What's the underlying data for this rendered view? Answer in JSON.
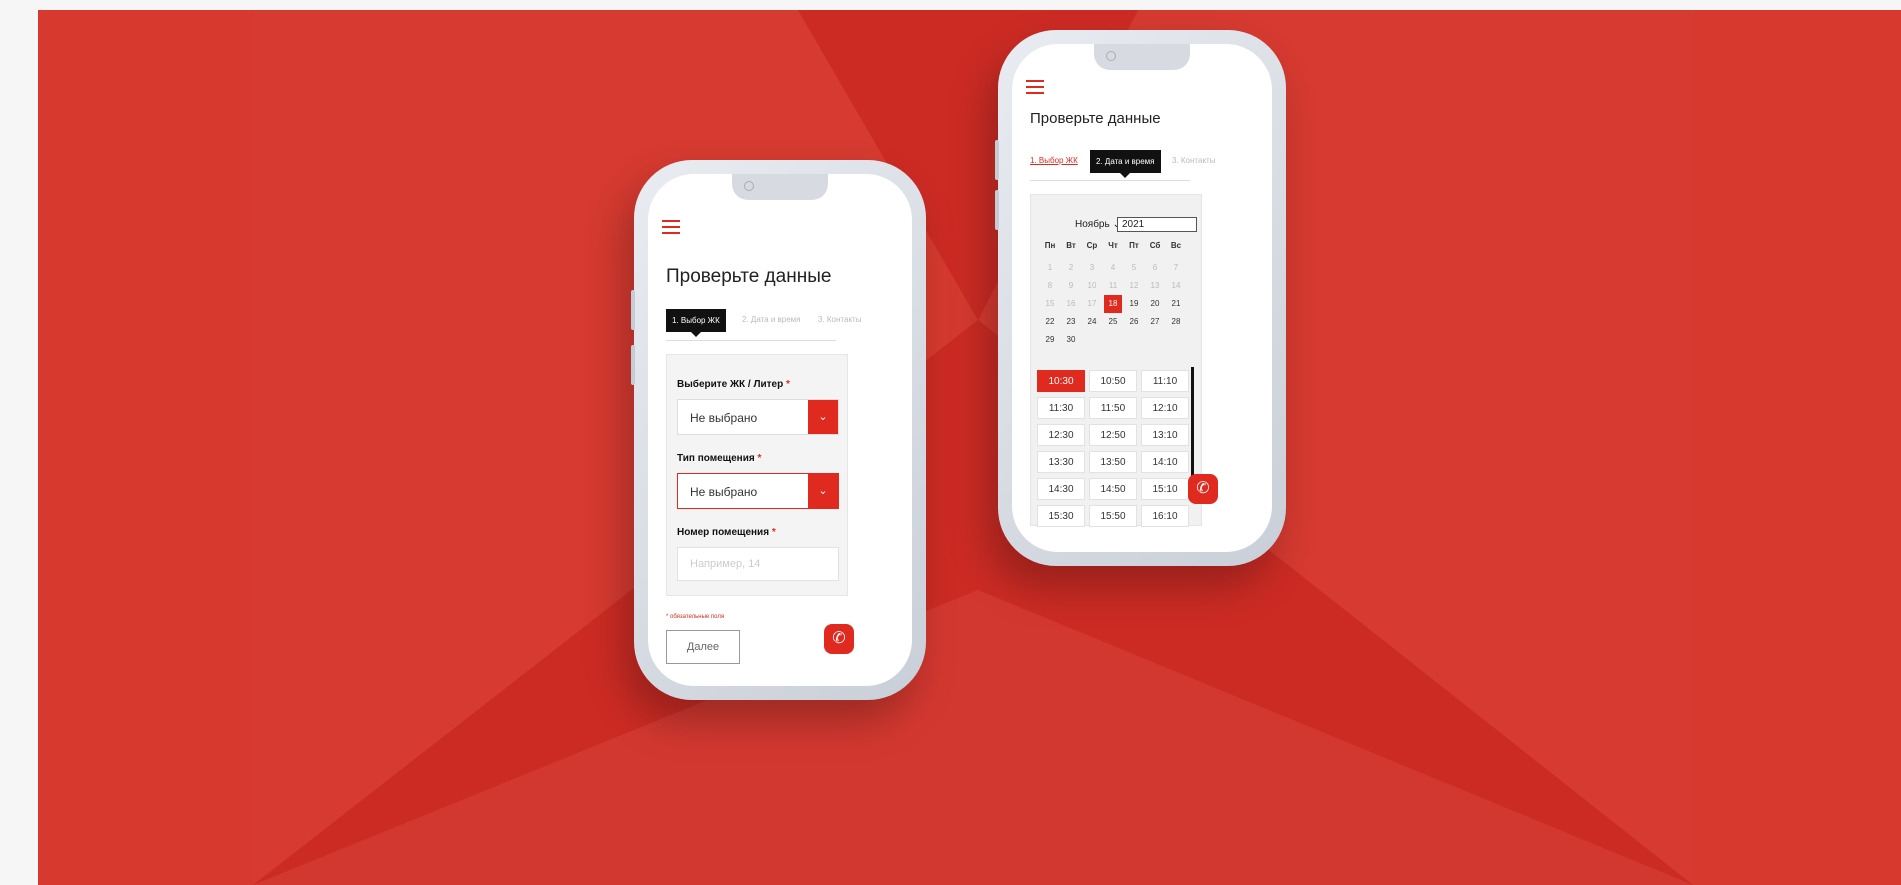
{
  "colors": {
    "background_red": "#cc2b24",
    "accent": "#e02a20",
    "phone_frame": "#dde1e7"
  },
  "left_phone": {
    "menu_icon": "hamburger-icon",
    "title": "Проверьте данные",
    "steps": {
      "step1": "1. Выбор ЖК",
      "step2": "2. Дата и время",
      "step3": "3. Контакты"
    },
    "form": {
      "complex_label": "Выберите ЖК / Литер",
      "complex_value": "Не выбрано",
      "type_label": "Тип помещения",
      "type_value": "Не выбрано",
      "number_label": "Номер помещения",
      "number_placeholder": "Например, 14",
      "required_mark": "*"
    },
    "required_note": "* обязательные поля",
    "next_button": "Далее",
    "call_icon": "phone-icon"
  },
  "right_phone": {
    "menu_icon": "hamburger-icon",
    "title": "Проверьте данные",
    "steps": {
      "step1": "1. Выбор ЖК",
      "step2": "2. Дата и время",
      "step3": "3. Контакты"
    },
    "calendar": {
      "month": "Ноябрь",
      "year": "2021",
      "weekdays": [
        "Пн",
        "Вт",
        "Ср",
        "Чт",
        "Пт",
        "Сб",
        "Вс"
      ],
      "days": [
        "1",
        "2",
        "3",
        "4",
        "5",
        "6",
        "7",
        "8",
        "9",
        "10",
        "11",
        "12",
        "13",
        "14",
        "15",
        "16",
        "17",
        "18",
        "19",
        "20",
        "21",
        "22",
        "23",
        "24",
        "25",
        "26",
        "27",
        "28",
        "29",
        "30"
      ],
      "selected_day": "18"
    },
    "times": [
      "10:30",
      "10:50",
      "11:10",
      "11:30",
      "11:50",
      "12:10",
      "12:30",
      "12:50",
      "13:10",
      "13:30",
      "13:50",
      "14:10",
      "14:30",
      "14:50",
      "15:10",
      "15:30",
      "15:50",
      "16:10"
    ],
    "selected_time": "10:30",
    "call_icon": "phone-icon"
  }
}
